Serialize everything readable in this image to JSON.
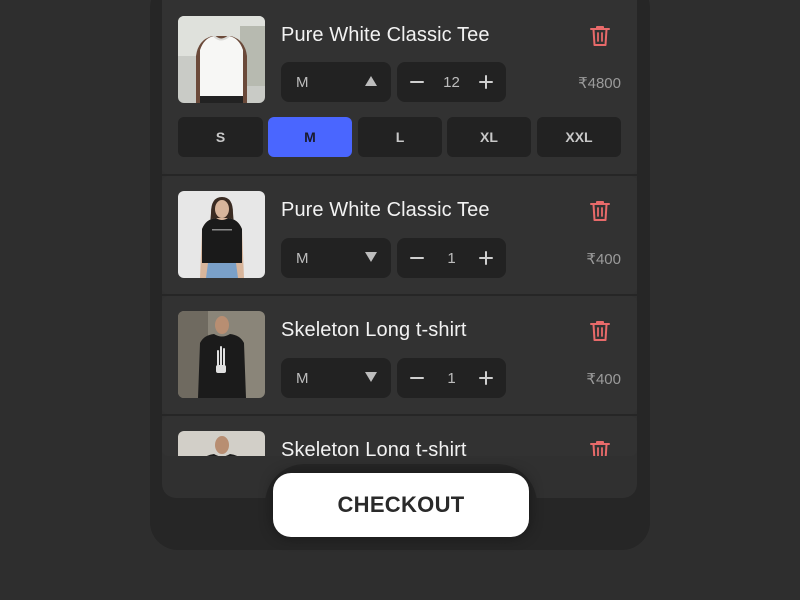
{
  "cart": {
    "items": [
      {
        "title": "Pure White Classic Tee",
        "size": "M",
        "size_dropdown_open": true,
        "quantity": "12",
        "price": "₹4800",
        "size_options": [
          "S",
          "M",
          "L",
          "XL",
          "XXL"
        ],
        "selected_size": "M",
        "thumb_icon": "white-tee-photo"
      },
      {
        "title": "Pure White Classic Tee",
        "size": "M",
        "quantity": "1",
        "price": "₹400",
        "thumb_icon": "black-tee-woman-photo"
      },
      {
        "title": "Skeleton Long t-shirt",
        "size": "M",
        "quantity": "1",
        "price": "₹400",
        "thumb_icon": "skeleton-tee-photo"
      },
      {
        "title": "Skeleton Long t-shirt",
        "thumb_icon": "skeleton-tee-photo"
      }
    ]
  },
  "checkout": {
    "label": "CHECKOUT"
  },
  "colors": {
    "accent": "#4a66ff",
    "delete": "#e86a6a",
    "background": "#2e2e2e",
    "card": "#323232",
    "control": "#222222"
  }
}
